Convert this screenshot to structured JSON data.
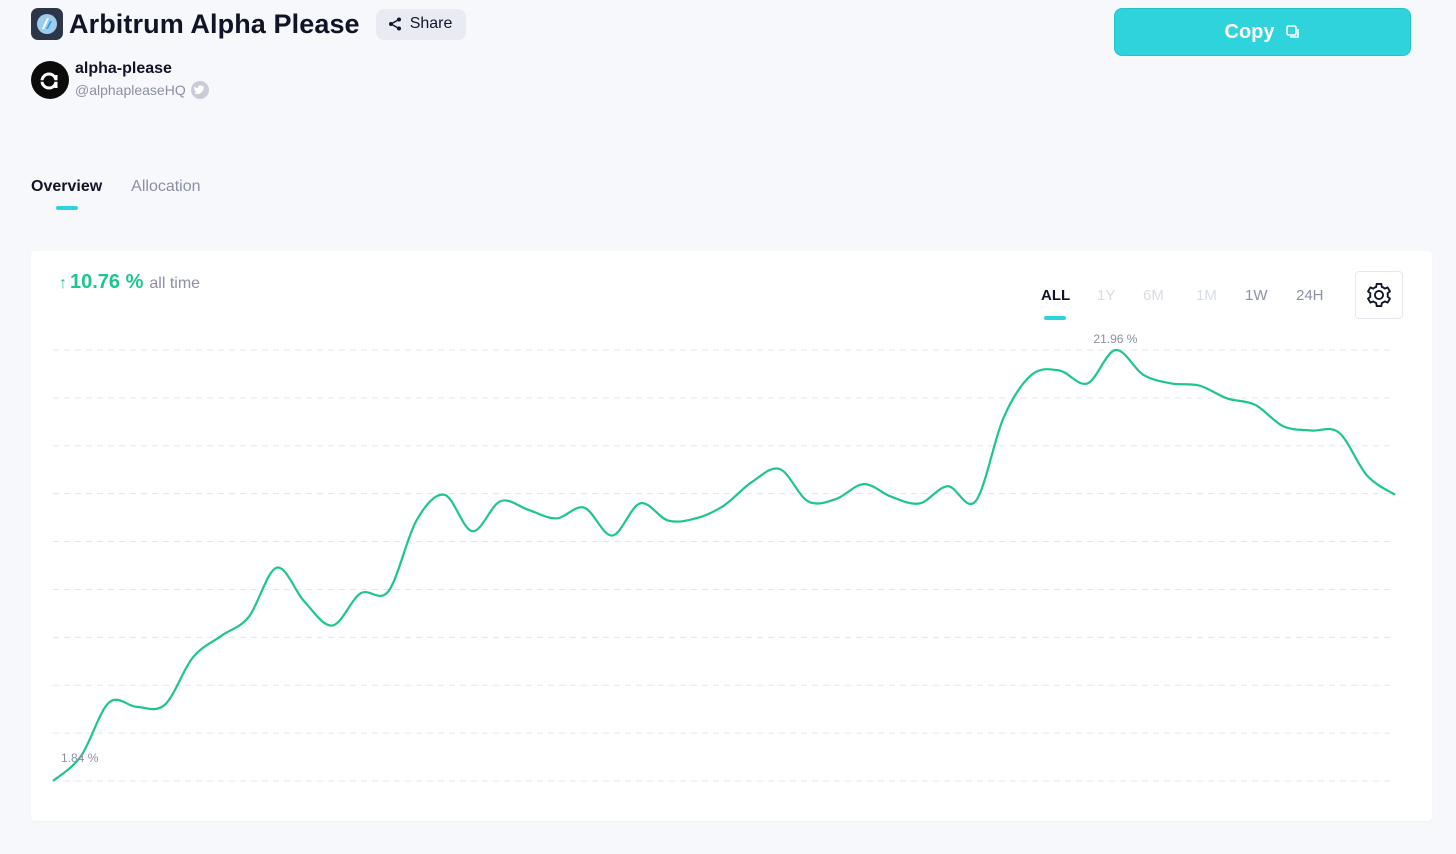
{
  "header": {
    "title": "Arbitrum Alpha Please",
    "share_label": "Share",
    "copy_label": "Copy"
  },
  "author": {
    "name": "alpha-please",
    "handle": "@alphapleaseHQ"
  },
  "tabs": [
    {
      "label": "Overview",
      "active": true
    },
    {
      "label": "Allocation",
      "active": false
    }
  ],
  "performance": {
    "value": "10.76 %",
    "label": "all time"
  },
  "time_ranges": [
    {
      "label": "ALL",
      "state": "active"
    },
    {
      "label": "1Y",
      "state": "disabled"
    },
    {
      "label": "6M",
      "state": "disabled"
    },
    {
      "label": "1M",
      "state": "disabled"
    },
    {
      "label": "1W",
      "state": "enabled"
    },
    {
      "label": "24H",
      "state": "enabled"
    }
  ],
  "colors": {
    "accent": "#2ed3dc",
    "line": "#1ec58d",
    "positive": "#1ec58d"
  },
  "chart_data": {
    "type": "line",
    "min_label": "1.84 %",
    "max_label": "21.96 %",
    "grid": true,
    "gridlines": 10,
    "series": [
      {
        "values": [
          1.84,
          3.0,
          5.5,
          5.3,
          5.4,
          7.6,
          8.6,
          9.5,
          11.8,
          10.2,
          9.1,
          10.6,
          10.7,
          14.0,
          15.2,
          13.5,
          14.9,
          14.5,
          14.1,
          14.6,
          13.3,
          14.8,
          14.0,
          14.1,
          14.7,
          15.8,
          16.4,
          14.9,
          15.0,
          15.7,
          15.1,
          14.8,
          15.6,
          14.9,
          18.8,
          20.8,
          21.0,
          20.4,
          21.96,
          20.8,
          20.4,
          20.3,
          19.7,
          19.4,
          18.4,
          18.2,
          18.1,
          16.1,
          15.2
        ]
      }
    ]
  }
}
